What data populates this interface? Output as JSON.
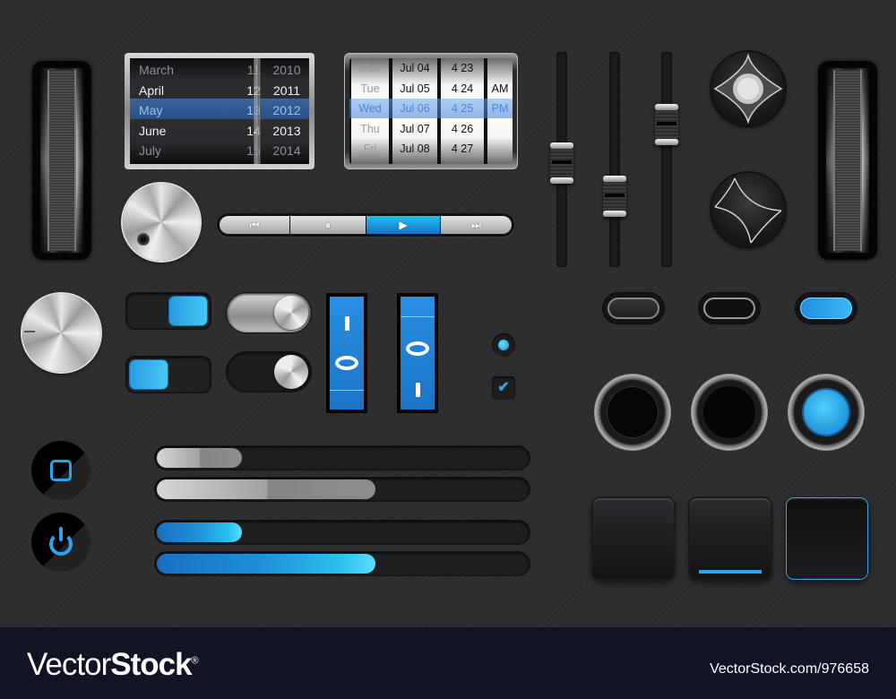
{
  "date_picker_dark": {
    "months": [
      "March",
      "April",
      "May",
      "June",
      "July"
    ],
    "days": [
      "11",
      "12",
      "13",
      "14",
      "15"
    ],
    "years": [
      "2010",
      "2011",
      "2012",
      "2013",
      "2014"
    ],
    "selected": {
      "month": "May",
      "day": "13",
      "year": "2012"
    }
  },
  "date_picker_light": {
    "weekdays": [
      "Mon",
      "Tue",
      "Wed",
      "Thu",
      "Fri"
    ],
    "dates": [
      "Jul 04",
      "Jul 05",
      "Jul 06",
      "Jul 07",
      "Jul 08"
    ],
    "times": [
      "4 23",
      "4 24",
      "4 25",
      "4 26",
      "4 27"
    ],
    "ampm": [
      "",
      "AM",
      "PM",
      "",
      ""
    ],
    "selected": {
      "weekday": "Wed",
      "date": "Jul 06",
      "time": "4 25",
      "ampm": "PM"
    }
  },
  "media_bar": {
    "buttons": [
      {
        "name": "previous",
        "glyph": "⏮"
      },
      {
        "name": "pause",
        "glyph": "⏸"
      },
      {
        "name": "play",
        "glyph": "▶",
        "active": true
      },
      {
        "name": "next",
        "glyph": "⏭"
      }
    ]
  },
  "sliders": {
    "levels": [
      0.48,
      0.29,
      0.7
    ]
  },
  "toggles": {
    "blue_switch_1": "on",
    "blue_switch_2": "off",
    "metal_pill_1": "on",
    "metal_pill_2": "off"
  },
  "rockers": {
    "rocker_1": {
      "top": "I",
      "bottom": "O",
      "state": "off"
    },
    "rocker_2": {
      "top": "O",
      "bottom": "I",
      "state": "on"
    }
  },
  "radio": {
    "checked": true
  },
  "checkbox": {
    "checked": true,
    "glyph": "✔"
  },
  "progress_bars": {
    "gray": [
      0.23,
      0.59
    ],
    "blue": [
      0.23,
      0.59
    ]
  },
  "mini_toggles": [
    "off",
    "off",
    "on"
  ],
  "round_buttons": [
    "idle",
    "pressed",
    "active"
  ],
  "square_buttons": [
    "idle",
    "selected",
    "focused"
  ],
  "icons": {
    "stop": "square-icon",
    "power": "power-icon"
  },
  "colors": {
    "accent": "#2aa3ea",
    "background": "#2c2c2e",
    "footer": "#121426"
  },
  "footer": {
    "brand_light": "Vector",
    "brand_bold": "Stock",
    "brand_mark": "®",
    "image_id": "VectorStock.com/976658"
  }
}
